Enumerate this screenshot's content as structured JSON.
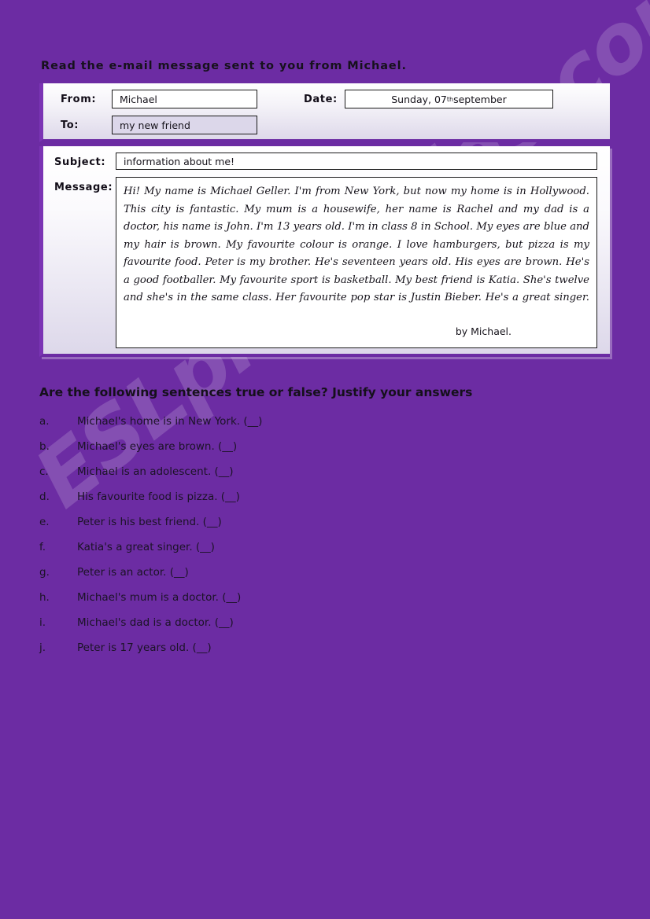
{
  "page": {
    "background_color": "#6C2CA3",
    "accent_color": "#7B34B4"
  },
  "watermark": {
    "text": "ESLprintables.com"
  },
  "instruction": "Read the e-mail message sent to you from Michael.",
  "email": {
    "labels": {
      "from": "From:",
      "to": "To:",
      "date": "Date:",
      "subject": "Subject:",
      "message": "Message:"
    },
    "from_value": "Michael",
    "to_value": "my new friend",
    "date_value_prefix": "Sunday, 07",
    "date_value_ordinal": "th",
    "date_value_suffix": " september",
    "subject_value": "information about me!",
    "message_body": "Hi! My name is Michael Geller. I'm from New York, but now my home is in Hollywood. This city is fantastic. My mum is a housewife, her name is Rachel and my dad is a doctor, his name is John. I'm 13 years old. I'm in class 8 in School. My eyes are blue and my hair is brown. My favourite colour is orange. I love hamburgers, but pizza is my favourite food. Peter is my brother. He's seventeen years old. His eyes are brown. He's a good footballer. My favourite sport is basketball. My best friend is Katia. She's twelve and she's in the same class. Her favourite pop star is Justin Bieber. He's a great singer.",
    "signature": "by Michael."
  },
  "questions": {
    "heading": "Are the following sentences true or false? Justify your answers",
    "items": [
      {
        "marker": "a.",
        "text": "Michael's home is in New York. (__)"
      },
      {
        "marker": "b.",
        "text": "Michael's eyes are brown. (__)"
      },
      {
        "marker": "c.",
        "text": "Michael is an adolescent. (__)"
      },
      {
        "marker": "d.",
        "text": "His favourite food is pizza. (__)"
      },
      {
        "marker": "e.",
        "text": "Peter is his best friend. (__)"
      },
      {
        "marker": "f.",
        "text": "Katia's a great singer. (__)"
      },
      {
        "marker": "g.",
        "text": "Peter is an actor. (__)"
      },
      {
        "marker": "h.",
        "text": "Michael's mum is a doctor. (__)"
      },
      {
        "marker": "i.",
        "text": "Michael's dad is a doctor. (__)"
      },
      {
        "marker": "j.",
        "text": "Peter is 17 years old. (__)"
      }
    ]
  }
}
